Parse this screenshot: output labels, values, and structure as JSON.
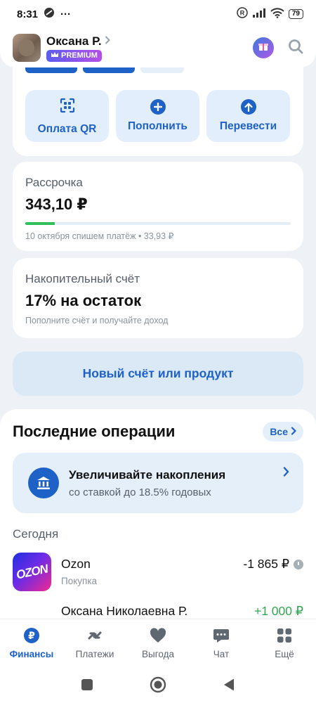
{
  "status_bar": {
    "time": "8:31",
    "dots": "···",
    "battery": "79"
  },
  "header": {
    "user_name": "Оксана Р.",
    "premium_label": "PREMIUM"
  },
  "actions": [
    {
      "label": "Оплата QR",
      "icon": "qr-scan-icon"
    },
    {
      "label": "Пополнить",
      "icon": "plus-icon"
    },
    {
      "label": "Перевести",
      "icon": "arrow-up-icon"
    }
  ],
  "installment": {
    "label": "Рассрочка",
    "amount": "343,10 ₽",
    "progress_fraction": 0.11,
    "note": "10 октября спишем платёж • 33,93 ₽"
  },
  "savings": {
    "label": "Накопительный счёт",
    "headline": "17% на остаток",
    "note": "Пополните счёт и получайте доход"
  },
  "new_product_label": "Новый счёт или продукт",
  "operations": {
    "title": "Последние операции",
    "all_label": "Все",
    "promo": {
      "title": "Увеличивайте накопления",
      "subtitle": "со ставкой до 18.5% годовых"
    },
    "date_header": "Сегодня",
    "items": [
      {
        "name": "Ozon",
        "category": "Покупка",
        "amount": "-1 865 ₽",
        "logo_text": "OZON"
      },
      {
        "name": "Оксана Николаевна Р.",
        "amount": "+1 000 ₽"
      }
    ]
  },
  "bottom_nav": [
    {
      "label": "Финансы",
      "active": true
    },
    {
      "label": "Платежи"
    },
    {
      "label": "Выгода"
    },
    {
      "label": "Чат"
    },
    {
      "label": "Ещё"
    }
  ],
  "colors": {
    "accent": "#1e62c8",
    "positive": "#2fa84f",
    "progress": "#2fbf5b"
  }
}
